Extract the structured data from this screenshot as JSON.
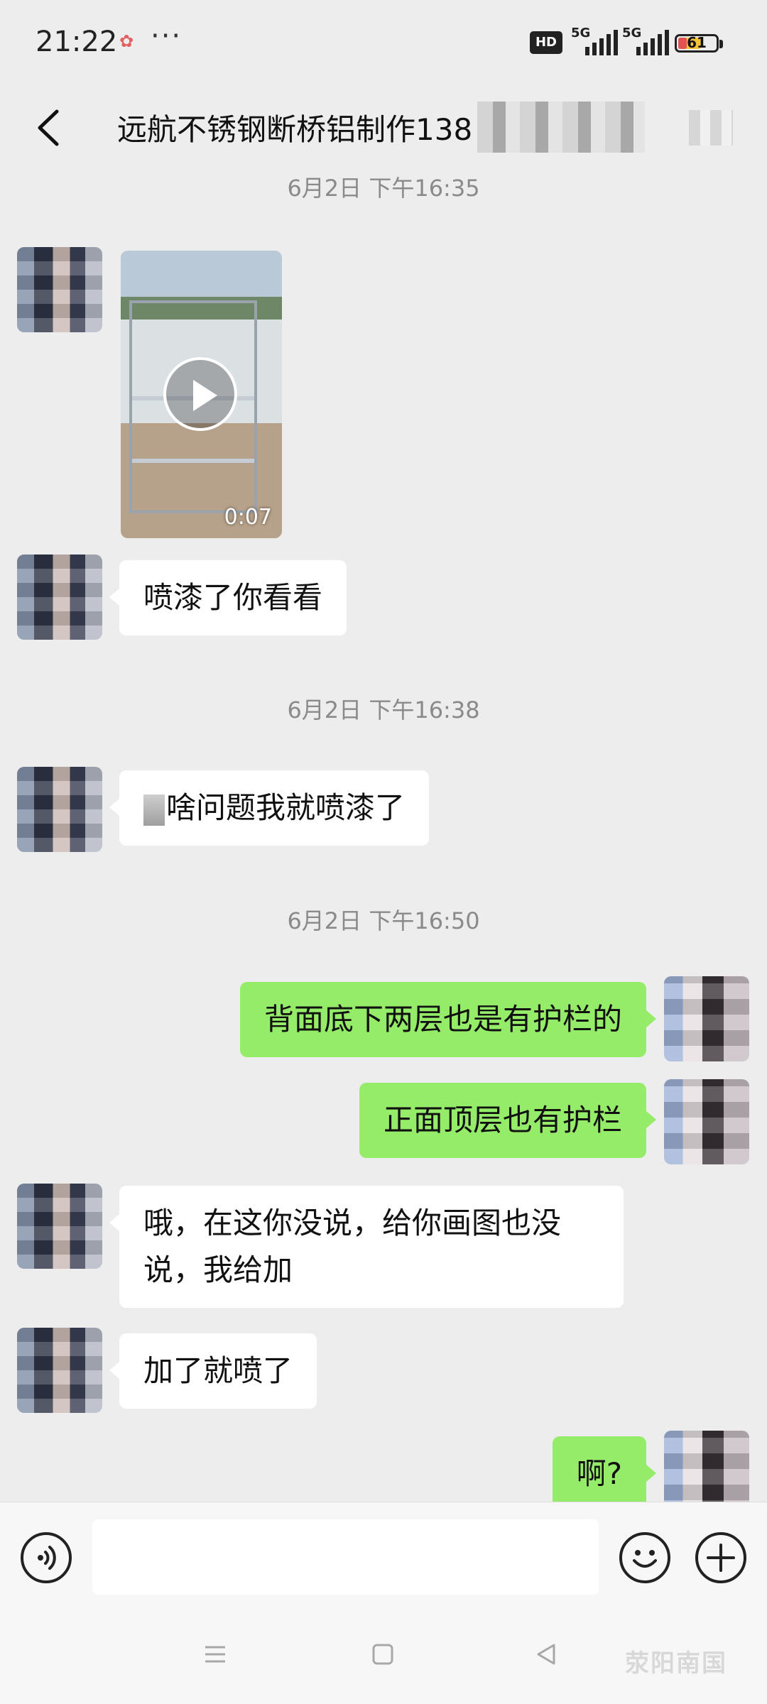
{
  "status_bar": {
    "time": "21:22",
    "dots": "···",
    "hd_label": "HD",
    "network_1": "5G",
    "network_2": "5G",
    "battery_level": "61"
  },
  "header": {
    "title": "远航不锈钢断桥铝制作13",
    "title_suffix": "8"
  },
  "chat": {
    "timestamps": [
      "6月2日 下午16:35",
      "6月2日 下午16:38",
      "6月2日 下午16:50"
    ],
    "video": {
      "duration": "0:07"
    },
    "messages": [
      {
        "from": "contact",
        "text": "喷漆了你看看"
      },
      {
        "from": "contact",
        "text": "啥问题我就喷漆了"
      },
      {
        "from": "me",
        "text": "背面底下两层也是有护栏的"
      },
      {
        "from": "me",
        "text": "正面顶层也有护栏"
      },
      {
        "from": "contact",
        "text_line1": "哦，在这你没说，给你画图也没",
        "text_line2": "说，我给加"
      },
      {
        "from": "contact",
        "text": "加了就喷了"
      },
      {
        "from": "me",
        "text": "啊?"
      }
    ]
  },
  "input_bar": {
    "value": "",
    "placeholder": ""
  },
  "navbar": {
    "watermark": "荥阳南国"
  },
  "colors": {
    "outgoing_bubble": "#95ec69",
    "incoming_bubble": "#ffffff",
    "background": "#ededed"
  }
}
